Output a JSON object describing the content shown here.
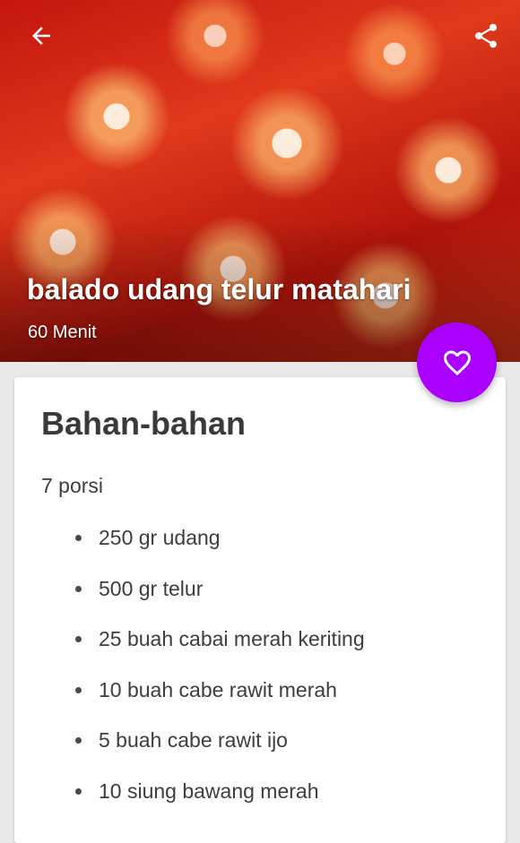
{
  "header": {
    "back_icon": "arrow-left-icon",
    "share_icon": "share-icon"
  },
  "recipe": {
    "title": "balado udang telur matahari",
    "duration": "60 Menit",
    "favorite_icon": "heart-outline-icon",
    "accent_color": "#aa00ff"
  },
  "ingredients_section": {
    "title": "Bahan-bahan",
    "servings": "7 porsi",
    "items": [
      "250 gr udang",
      "500 gr telur",
      "25 buah cabai merah keriting",
      "10 buah cabe rawit merah",
      "5 buah cabe rawit ijo",
      "10 siung bawang merah"
    ]
  }
}
